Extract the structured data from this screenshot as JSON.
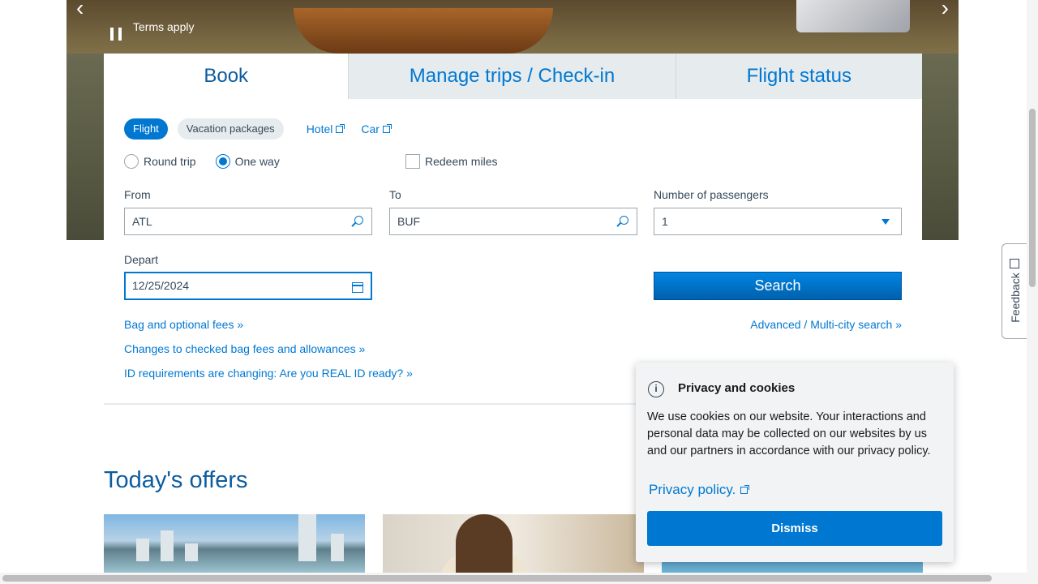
{
  "hero": {
    "terms": "Terms apply",
    "prev_arrow": "‹",
    "next_arrow": "›"
  },
  "tabs": [
    {
      "label": "Book"
    },
    {
      "label": "Manage trips / Check-in"
    },
    {
      "label": "Flight status"
    }
  ],
  "booking": {
    "trip_types": [
      {
        "label": "Flight",
        "active": true
      },
      {
        "label": "Vacation packages",
        "active": false
      }
    ],
    "external_links": [
      {
        "label": "Hotel"
      },
      {
        "label": "Car"
      }
    ],
    "round_trip_label": "Round trip",
    "one_way_label": "One way",
    "selected_trip": "One way",
    "redeem_label": "Redeem miles",
    "from_label": "From",
    "from_value": "ATL",
    "to_label": "To",
    "to_value": "BUF",
    "passengers_label": "Number of passengers",
    "passengers_value": "1",
    "depart_label": "Depart",
    "depart_value": "12/25/2024",
    "search_label": "Search",
    "advanced_link": "Advanced / Multi-city search »",
    "links": [
      "Bag and optional fees »",
      "Changes to checked bag fees and allowances »",
      "ID requirements are changing: Are you REAL ID ready? »"
    ]
  },
  "offers": {
    "title": "Today's offers"
  },
  "feedback": {
    "label": "Feedback"
  },
  "cookie": {
    "title": "Privacy and cookies",
    "body": "We use cookies on our website. Your interactions and personal data may be collected on our websites by us and our partners in accordance with our privacy policy.",
    "link": "Privacy policy.",
    "dismiss": "Dismiss"
  },
  "colors": {
    "brand_blue": "#0078d2",
    "heading_blue": "#0c5c9e",
    "text": "#36495a"
  }
}
